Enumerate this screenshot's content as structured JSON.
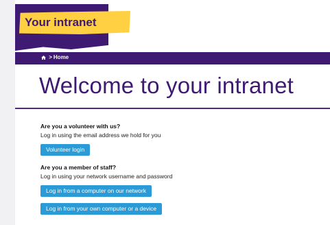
{
  "brand": {
    "logo_text": "Your intranet"
  },
  "nav": {
    "home_icon": "home-icon",
    "separator": ">",
    "home_label": "Home"
  },
  "main": {
    "heading": "Welcome to your intranet",
    "volunteer_question": "Are you a volunteer with us?",
    "volunteer_text": "Log in using the email address we hold for you",
    "volunteer_button": "Volunteer login",
    "staff_question": "Are you a member of staff?",
    "staff_text": "Log in using your network username and password",
    "network_button": "Log in from a computer on our network",
    "device_button": "Log in from your own computer or a device"
  },
  "colors": {
    "purple": "#3f1a73",
    "yellow": "#ffd042",
    "button": "#2b9bd8"
  }
}
